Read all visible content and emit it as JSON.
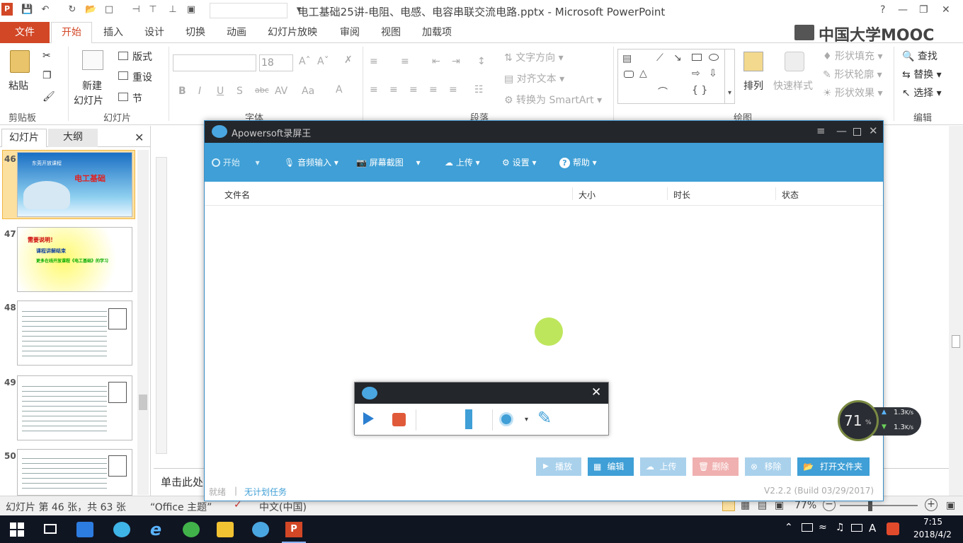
{
  "window": {
    "title": "电工基础25讲-电阻、电感、电容串联交流电路.pptx - Microsoft PowerPoint"
  },
  "tabs": {
    "file": "文件",
    "items": [
      "开始",
      "插入",
      "设计",
      "切换",
      "动画",
      "幻灯片放映",
      "审阅",
      "视图",
      "加载项"
    ]
  },
  "brand": {
    "logo_text": "中国大学MOOC"
  },
  "ribbon": {
    "paste": "粘贴",
    "new_slide_line1": "新建",
    "new_slide_line2": "幻灯片",
    "layout": "版式",
    "reset": "重设",
    "section": "节",
    "font_size": "18",
    "text_direction": "文字方向",
    "align_text": "对齐文本",
    "smartart": "转换为 SmartArt",
    "arrange": "排列",
    "quick_styles": "快速样式",
    "shape_fill": "形状填充",
    "shape_outline": "形状轮廓",
    "shape_effects": "形状效果",
    "find": "查找",
    "replace": "替换",
    "select": "选择",
    "groups": {
      "clipboard": "剪贴板",
      "slides": "幻灯片",
      "font": "字体",
      "paragraph": "段落",
      "drawing": "绘图",
      "editing": "编辑"
    }
  },
  "leftpane": {
    "tab_slides": "幻灯片",
    "tab_outline": "大纲",
    "slides": [
      {
        "num": "46",
        "title": "电工基础",
        "subtitle": "东莞开放课程"
      },
      {
        "num": "47",
        "title": "需要说明！",
        "line1": "课程讲解结束",
        "line2": "更多在线开放课程《电工基础》的学习"
      },
      {
        "num": "48"
      },
      {
        "num": "49"
      },
      {
        "num": "50"
      }
    ]
  },
  "notes": {
    "placeholder": "单击此处"
  },
  "statusbar": {
    "slide_info": "幻灯片 第 46 张，共 63 张",
    "theme": "“Office 主题”",
    "language": "中文(中国)",
    "zoom": "77%"
  },
  "apowersoft": {
    "title": "Apowersoft录屏王",
    "toolbar": {
      "start": "开始",
      "audio": "音频输入",
      "screenshot": "屏幕截图",
      "upload": "上传",
      "settings": "设置",
      "help": "帮助"
    },
    "columns": [
      "文件名",
      "大小",
      "时长",
      "状态"
    ],
    "buttons": {
      "play": "播放",
      "edit": "编辑",
      "upload": "上传",
      "delete": "删除",
      "remove": "移除",
      "open_folder": "打开文件夹"
    },
    "status_ready": "就绪",
    "no_task": "无计划任务",
    "version": "V2.2.2 (Build 03/29/2017)"
  },
  "netmeter": {
    "percent": "71",
    "unit": "%",
    "up": "1.3",
    "down": "1.3",
    "rate_unit": "K/s"
  },
  "taskbar": {
    "time": "7:15",
    "date": "2018/4/2",
    "ime": "A"
  },
  "colors": {
    "file_tab": "#d24726",
    "apo_toolbar": "#3f9fd6",
    "apo_title": "#23262b",
    "taskbar": "#101522",
    "cursor_dot": "#b7e34a"
  }
}
